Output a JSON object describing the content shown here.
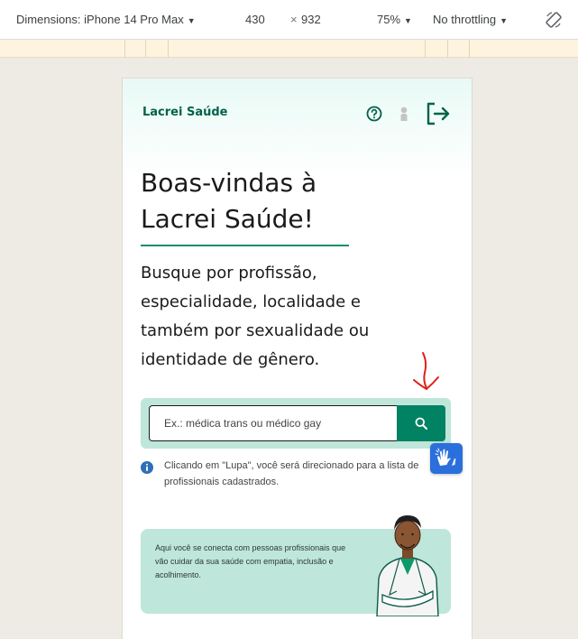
{
  "devtools": {
    "dimensions_label": "Dimensions: iPhone 14 Pro Max",
    "width": "430",
    "times": "×",
    "height": "932",
    "zoom": "75%",
    "throttling": "No throttling",
    "caret": "▼",
    "rotate_icon": "rotate-icon"
  },
  "app": {
    "brand": "Lacrei Saúde",
    "header_icons": [
      "help-icon",
      "user-icon",
      "logout-icon"
    ],
    "title_line1": "Boas-vindas à",
    "title_line2": "Lacrei Saúde!",
    "subtitle": "Busque por profissão, especialidade, localidade e também por sexualidade ou identidade de gênero.",
    "search": {
      "placeholder": "Ex.: médica trans ou médico gay",
      "value": "",
      "button_icon": "search-icon"
    },
    "info_text": "Clicando em \"Lupa\", você será direcionado para a lista de profissionais cadastrados.",
    "promo_text": "Aqui você se conecta com pessoas profissionais que vão cuidar da sua saúde com empatia, inclusão e acolhimento."
  },
  "colors": {
    "brand_green": "#01634a",
    "button_green": "#018262",
    "mint": "#bfe6da",
    "annotation_red": "#e0201a",
    "accessibility_blue": "#2a6fdb"
  }
}
